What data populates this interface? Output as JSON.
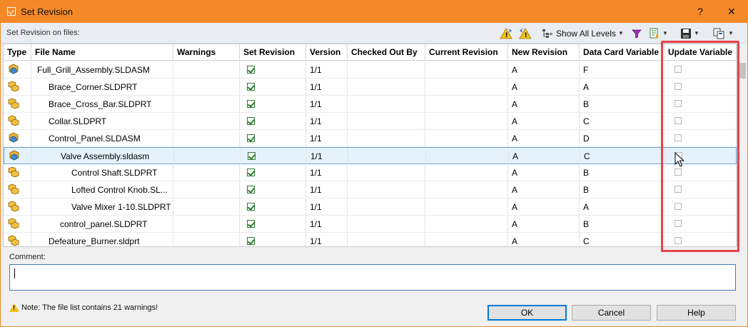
{
  "window": {
    "title": "Set Revision",
    "help_label": "?",
    "close_label": "✕"
  },
  "toolbar": {
    "label": "Set Revision on files:",
    "show_all_levels_label": "Show All Levels"
  },
  "columns": [
    "Type",
    "File Name",
    "Warnings",
    "Set Revision",
    "Version",
    "Checked Out By",
    "Current Revision",
    "New Revision",
    "Data Card Variable",
    "Update Variable"
  ],
  "rows": [
    {
      "type": "assembly",
      "name": "Full_Grill_Assembly.SLDASM",
      "warnings": "",
      "version": "1/1",
      "checked_out_by": "",
      "current_revision": "",
      "new_revision": "A",
      "data_card_variable": "F"
    },
    {
      "type": "part",
      "name": "Brace_Corner.SLDPRT",
      "warnings": "",
      "version": "1/1",
      "checked_out_by": "",
      "current_revision": "",
      "new_revision": "A",
      "data_card_variable": "A"
    },
    {
      "type": "part",
      "name": "Brace_Cross_Bar.SLDPRT",
      "warnings": "",
      "version": "1/1",
      "checked_out_by": "",
      "current_revision": "",
      "new_revision": "A",
      "data_card_variable": "B"
    },
    {
      "type": "part",
      "name": "Collar.SLDPRT",
      "warnings": "",
      "version": "1/1",
      "checked_out_by": "",
      "current_revision": "",
      "new_revision": "A",
      "data_card_variable": "C"
    },
    {
      "type": "assembly",
      "name": "Control_Panel.SLDASM",
      "warnings": "",
      "version": "1/1",
      "checked_out_by": "",
      "current_revision": "",
      "new_revision": "A",
      "data_card_variable": "D"
    },
    {
      "type": "assembly",
      "name": "Valve Assembly.sldasm",
      "warnings": "",
      "version": "1/1",
      "checked_out_by": "",
      "current_revision": "",
      "new_revision": "A",
      "data_card_variable": "C"
    },
    {
      "type": "part",
      "name": "Control Shaft.SLDPRT",
      "warnings": "",
      "version": "1/1",
      "checked_out_by": "",
      "current_revision": "",
      "new_revision": "A",
      "data_card_variable": "B"
    },
    {
      "type": "part",
      "name": "Lofted Control Knob.SL...",
      "warnings": "",
      "version": "1/1",
      "checked_out_by": "",
      "current_revision": "",
      "new_revision": "A",
      "data_card_variable": "B"
    },
    {
      "type": "part",
      "name": "Valve Mixer 1-10.SLDPRT",
      "warnings": "",
      "version": "1/1",
      "checked_out_by": "",
      "current_revision": "",
      "new_revision": "A",
      "data_card_variable": "A"
    },
    {
      "type": "part",
      "name": "control_panel.SLDPRT",
      "warnings": "",
      "version": "1/1",
      "checked_out_by": "",
      "current_revision": "",
      "new_revision": "A",
      "data_card_variable": "B"
    },
    {
      "type": "part",
      "name": "Defeature_Burner.sldprt",
      "warnings": "",
      "version": "1/1",
      "checked_out_by": "",
      "current_revision": "",
      "new_revision": "A",
      "data_card_variable": "C"
    }
  ],
  "comment": {
    "label": "Comment:",
    "value": ""
  },
  "note": "Note: The file list contains 21 warnings!",
  "buttons": {
    "ok": "OK",
    "cancel": "Cancel",
    "help": "Help"
  },
  "colors": {
    "title_bar": "#f5892a",
    "highlight": "#e8424a",
    "selected_row": "#e5f2fb"
  }
}
